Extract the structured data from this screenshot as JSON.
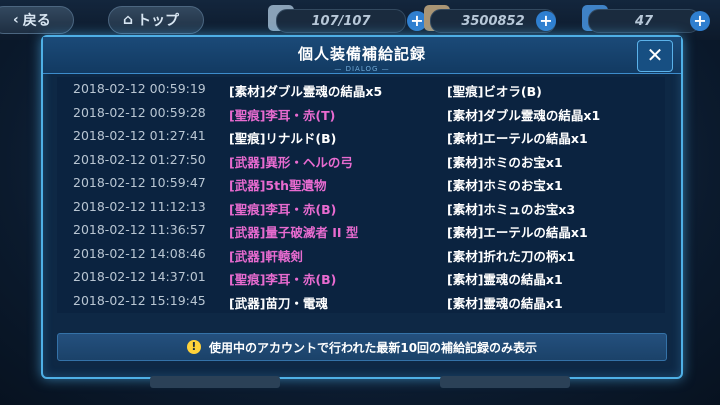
{
  "topbar": {
    "back_label": "戻る",
    "top_label": "トップ",
    "stamina": "107/107",
    "coins": "3500852",
    "crystals": "47"
  },
  "colors": {
    "white_item": "#ffffff",
    "pink_item": "#e86bd0",
    "accent": "#4fb0e6"
  },
  "dialog": {
    "title": "個人装備補給記録",
    "subtitle": "— DIALOG —",
    "close_symbol": "✕",
    "notice": "使用中のアカウントで行われた最新10回の補給記録のみ表示",
    "records": [
      {
        "date": "2018-02-12 00:59:19",
        "item1": "[素材]ダブル霊魂の結晶x5",
        "item1_color": "#ffffff",
        "item2": "[聖痕]ビオラ(B)",
        "item2_color": "#ffffff"
      },
      {
        "date": "2018-02-12 00:59:28",
        "item1": "[聖痕]李耳・赤(T)",
        "item1_color": "#e86bd0",
        "item2": "[素材]ダブル霊魂の結晶x1",
        "item2_color": "#ffffff"
      },
      {
        "date": "2018-02-12 01:27:41",
        "item1": "[聖痕]リナルド(B)",
        "item1_color": "#ffffff",
        "item2": "[素材]エーテルの結晶x1",
        "item2_color": "#ffffff"
      },
      {
        "date": "2018-02-12 01:27:50",
        "item1": "[武器]異形・ヘルの弓",
        "item1_color": "#e86bd0",
        "item2": "[素材]ホミのお宝x1",
        "item2_color": "#ffffff"
      },
      {
        "date": "2018-02-12 10:59:47",
        "item1": "[武器]5th聖遺物",
        "item1_color": "#e86bd0",
        "item2": "[素材]ホミのお宝x1",
        "item2_color": "#ffffff"
      },
      {
        "date": "2018-02-12 11:12:13",
        "item1": "[聖痕]李耳・赤(B)",
        "item1_color": "#e86bd0",
        "item2": "[素材]ホミュのお宝x3",
        "item2_color": "#ffffff"
      },
      {
        "date": "2018-02-12 11:36:57",
        "item1": "[武器]量子破滅者 II 型",
        "item1_color": "#e86bd0",
        "item2": "[素材]エーテルの結晶x1",
        "item2_color": "#ffffff"
      },
      {
        "date": "2018-02-12 14:08:46",
        "item1": "[武器]軒轅剣",
        "item1_color": "#e86bd0",
        "item2": "[素材]折れた刀の柄x1",
        "item2_color": "#ffffff"
      },
      {
        "date": "2018-02-12 14:37:01",
        "item1": "[聖痕]李耳・赤(B)",
        "item1_color": "#e86bd0",
        "item2": "[素材]霊魂の結晶x1",
        "item2_color": "#ffffff"
      },
      {
        "date": "2018-02-12 15:19:45",
        "item1": "[武器]苗刀・電魂",
        "item1_color": "#ffffff",
        "item2": "[素材]霊魂の結晶x1",
        "item2_color": "#ffffff"
      }
    ]
  }
}
